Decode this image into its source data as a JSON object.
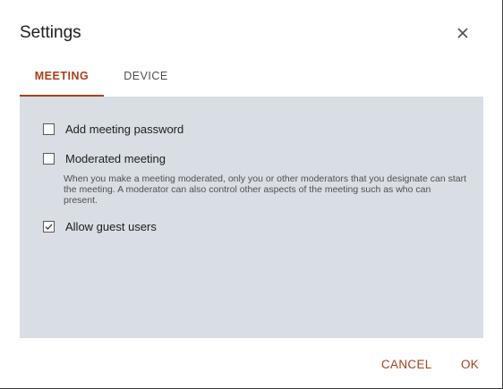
{
  "dialog": {
    "title": "Settings"
  },
  "tabs": [
    {
      "label": "MEETING",
      "active": true
    },
    {
      "label": "DEVICE",
      "active": false
    }
  ],
  "options": [
    {
      "label": "Add meeting password",
      "checked": false
    },
    {
      "label": "Moderated meeting",
      "checked": false
    },
    {
      "label": "Allow guest users",
      "checked": true
    }
  ],
  "moderated_description": "When you make a meeting moderated, only you or other moderators that you designate can start the meeting. A moderator can also control other aspects of the meeting such as who can present.",
  "actions": {
    "cancel_label": "CANCEL",
    "ok_label": "OK"
  },
  "colors": {
    "accent": "#a8401a",
    "panel_bg": "#d8dee3"
  },
  "icons": {
    "close": "close-icon",
    "check": "checkmark-icon"
  }
}
